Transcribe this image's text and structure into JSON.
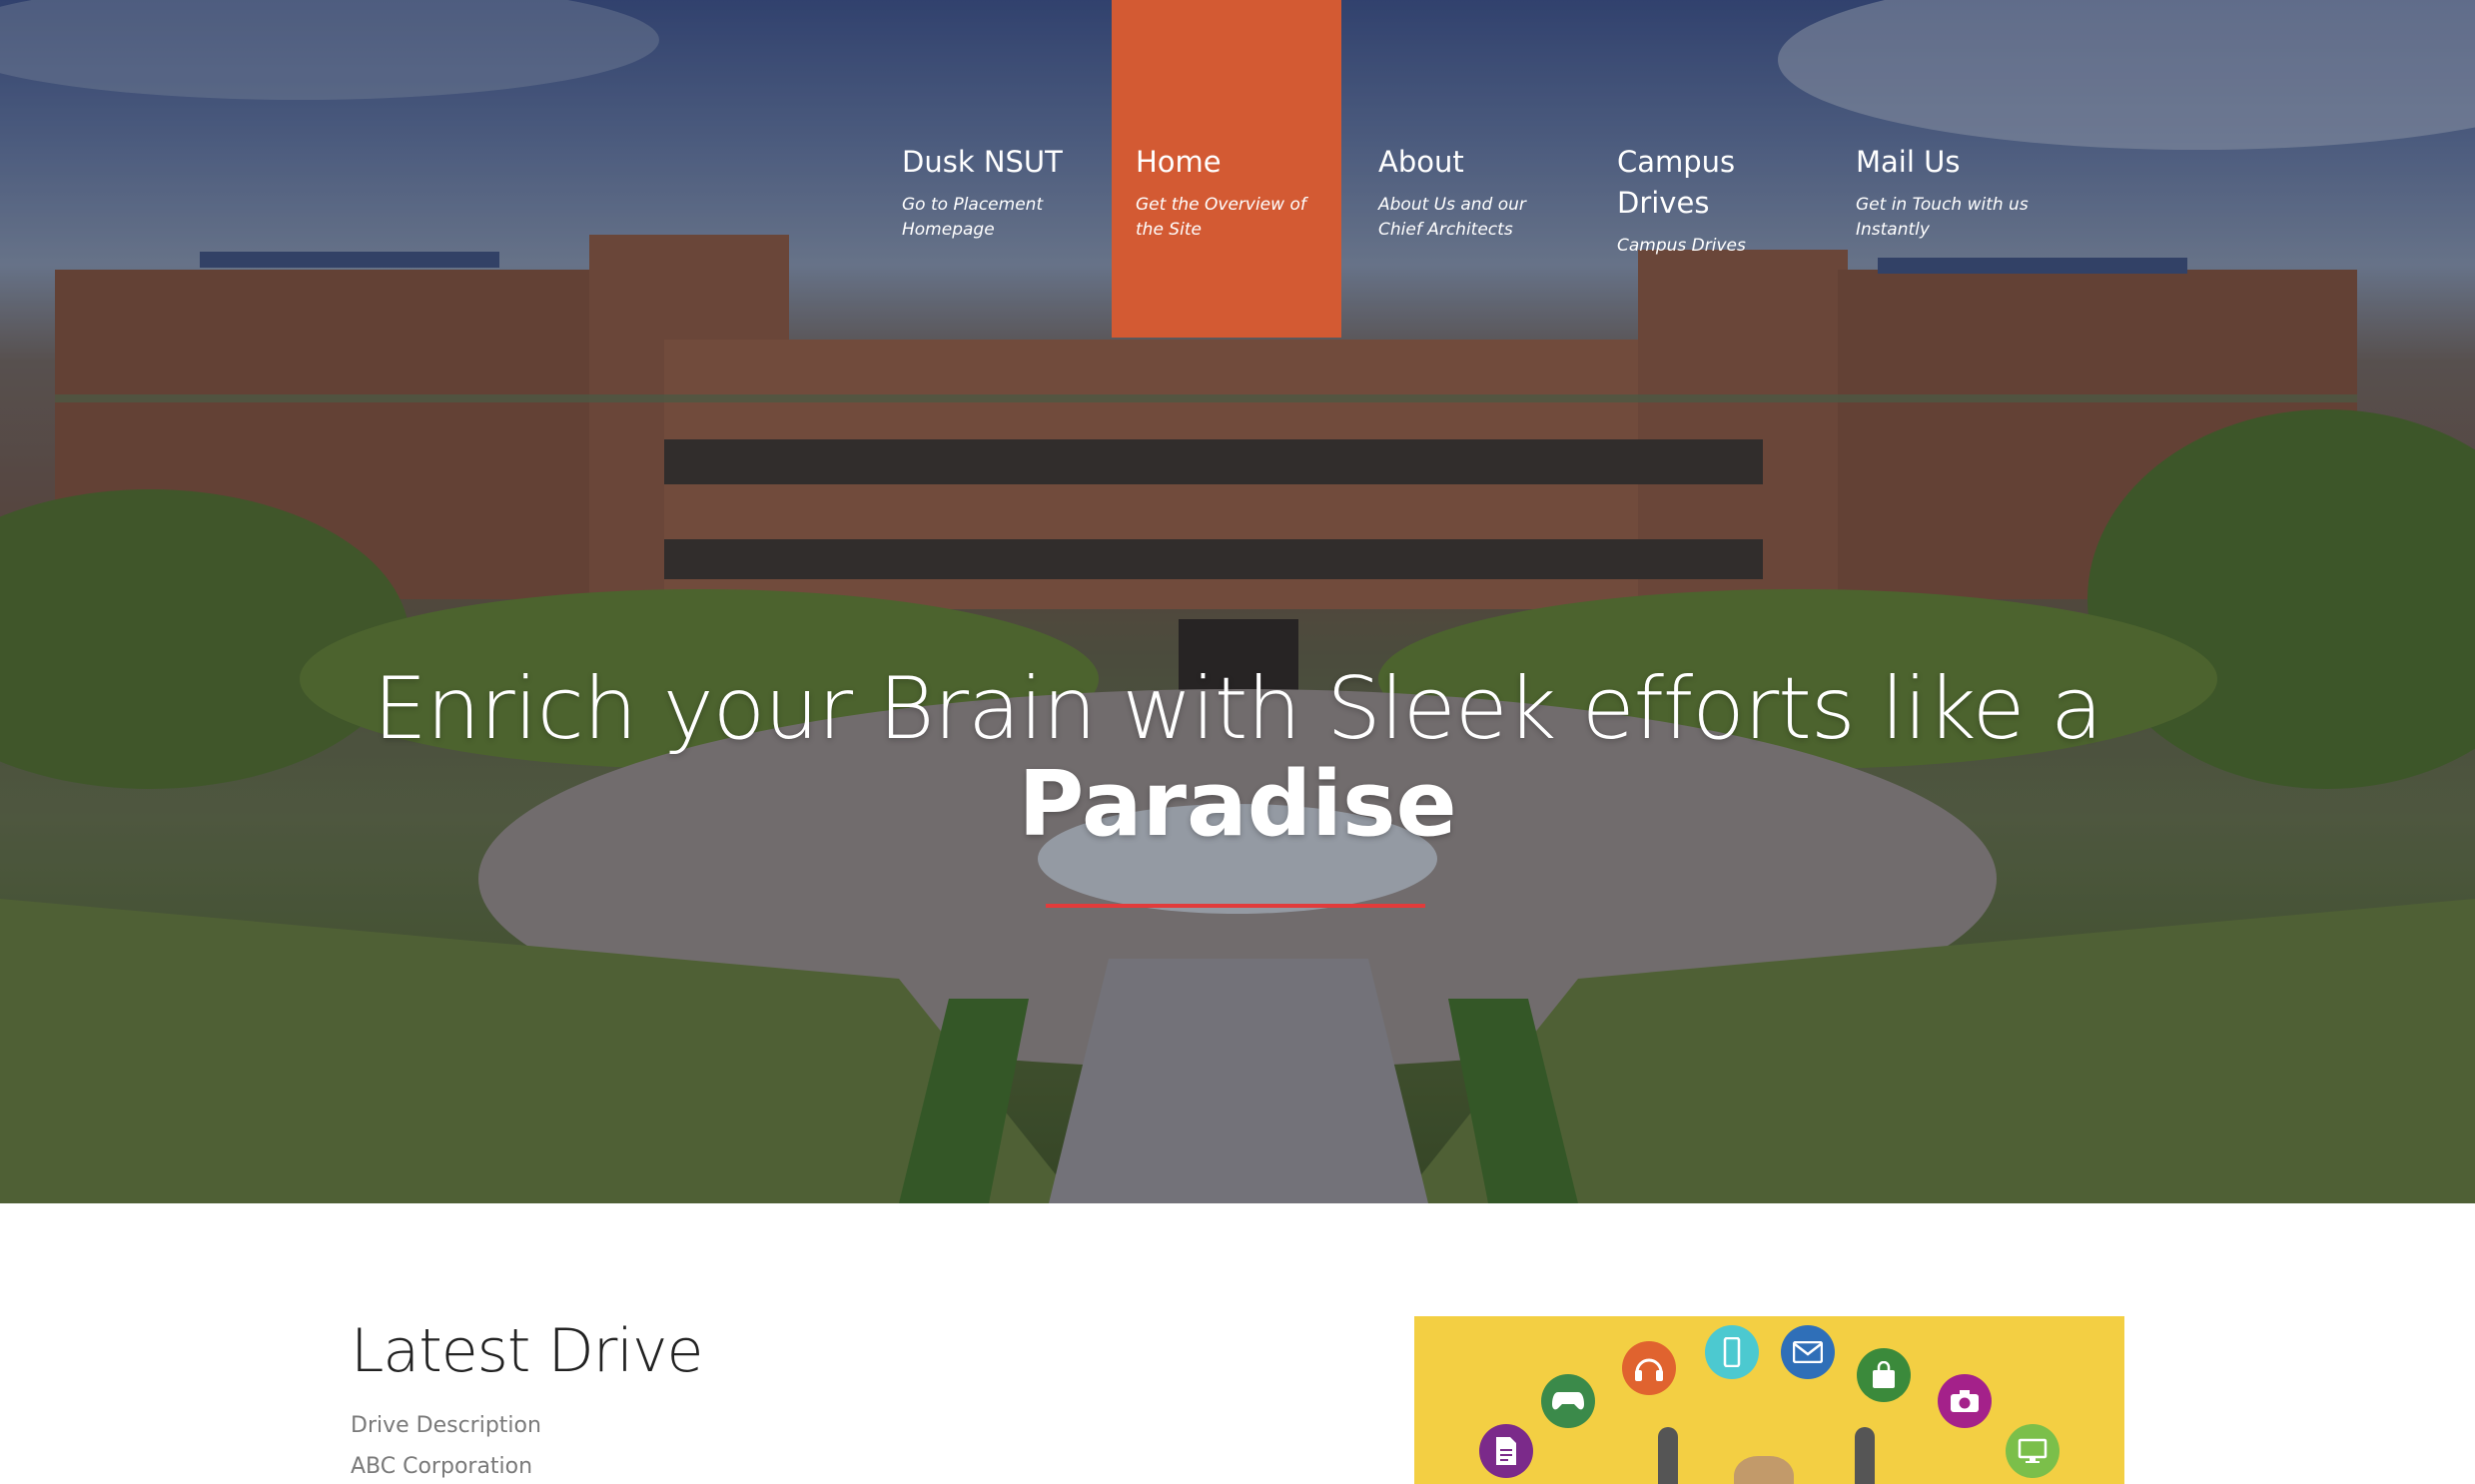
{
  "nav": {
    "items": [
      {
        "title": "Dusk NSUT",
        "subtitle": "Go to Placement Homepage",
        "active": false
      },
      {
        "title": "Home",
        "subtitle": "Get the Overview of the Site",
        "active": true
      },
      {
        "title": "About",
        "subtitle": "About Us and our Chief Architects",
        "active": false
      },
      {
        "title": "Campus Drives",
        "subtitle": "Campus Drives",
        "active": false
      },
      {
        "title": "Mail Us",
        "subtitle": "Get in Touch with us Instantly",
        "active": false
      }
    ]
  },
  "hero": {
    "headline": "Enrich your Brain with Sleek efforts like a",
    "headline_bold": "Paradise"
  },
  "latest_drive": {
    "title": "Latest Drive",
    "description": "Drive Description",
    "company": "ABC Corporation"
  },
  "illustration": {
    "icons": [
      "document-icon",
      "gamepad-icon",
      "headphones-icon",
      "phone-icon",
      "mail-icon",
      "shopping-bag-icon",
      "camera-icon",
      "monitor-icon"
    ]
  },
  "colors": {
    "accent": "#d35a33",
    "headline_rule": "#e23b3b",
    "illustration_bg": "#f3cf43"
  }
}
